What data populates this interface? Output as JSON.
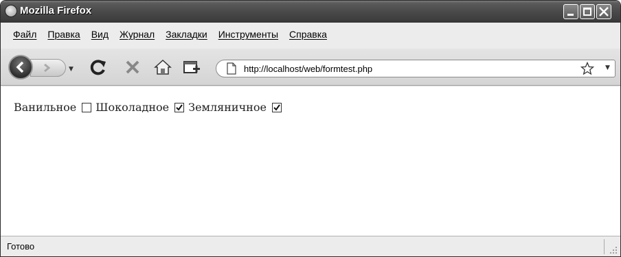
{
  "window": {
    "title": "Mozilla Firefox"
  },
  "menu": {
    "items": [
      {
        "label": "Файл"
      },
      {
        "label": "Правка"
      },
      {
        "label": "Вид"
      },
      {
        "label": "Журнал"
      },
      {
        "label": "Закладки"
      },
      {
        "label": "Инструменты"
      },
      {
        "label": "Справка"
      }
    ]
  },
  "navbar": {
    "url": "http://localhost/web/formtest.php"
  },
  "content": {
    "options": [
      {
        "label": "Ванильное",
        "checked": false
      },
      {
        "label": "Шоколадное",
        "checked": true
      },
      {
        "label": "Земляничное",
        "checked": true
      }
    ]
  },
  "status": {
    "text": "Готово"
  },
  "icons": [
    "firefox-icon",
    "minimize-icon",
    "maximize-icon",
    "close-icon",
    "back-arrow-icon",
    "forward-arrow-icon",
    "reload-icon",
    "stop-icon",
    "home-icon",
    "new-tab-icon",
    "page-icon",
    "star-icon",
    "resize-grip-icon"
  ]
}
